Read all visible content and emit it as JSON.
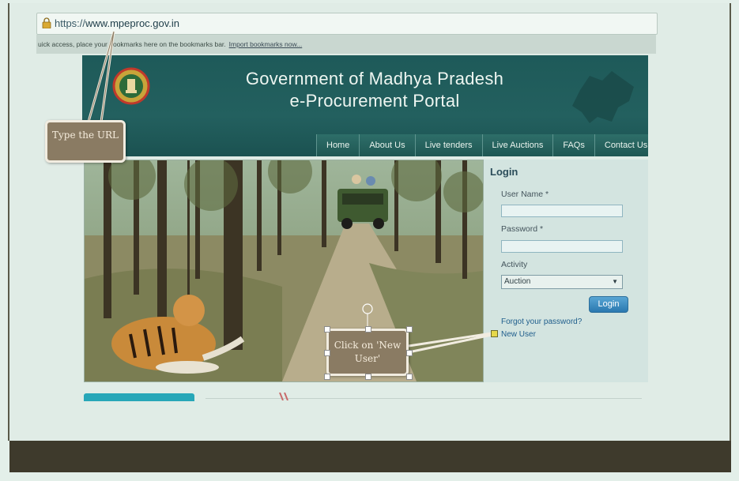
{
  "browser": {
    "url_scheme": "https://",
    "url_host": "www.mpeproc.gov.in",
    "bookmarks_hint": "uick access, place your bookmarks here on the bookmarks bar.",
    "bookmarks_link": "Import bookmarks now..."
  },
  "header": {
    "title_line1": "Government of Madhya Pradesh",
    "title_line2": "e-Procurement Portal"
  },
  "nav": {
    "items": [
      "Home",
      "About Us",
      "Live tenders",
      "Live Auctions",
      "FAQs",
      "Contact Us"
    ]
  },
  "login": {
    "heading": "Login",
    "username_label": "User Name *",
    "password_label": "Password *",
    "activity_label": "Activity",
    "activity_selected": "Auction",
    "button_label": "Login",
    "forgot_link": "Forgot your password?",
    "new_user_link": "New User"
  },
  "annotations": {
    "url_callout": "Type the URL",
    "new_user_callout": "Click on 'New User'"
  },
  "colors": {
    "header_bg": "#1e5a59",
    "nav_bg": "#246461",
    "login_button": "#3b8fc6",
    "callout_bg": "#8a7b63",
    "footer_bg": "#3e3a2c"
  }
}
